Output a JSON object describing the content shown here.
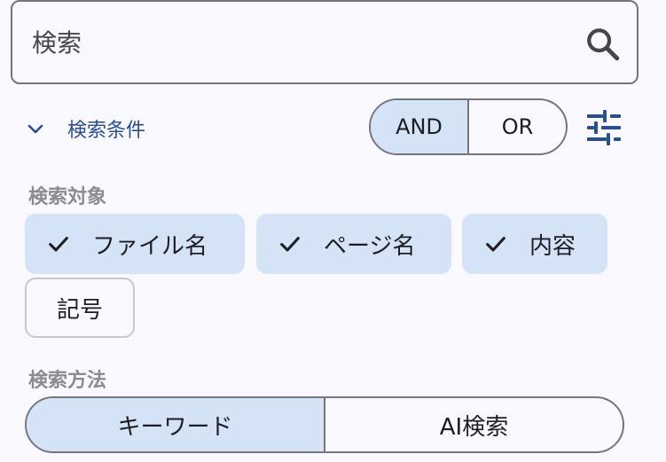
{
  "search": {
    "placeholder": "検索",
    "icon": "search-icon"
  },
  "conditions": {
    "label": "検索条件",
    "expanded": true,
    "logic": {
      "options": [
        "AND",
        "OR"
      ],
      "selected": "AND"
    },
    "filter_icon": "tune-icon"
  },
  "target": {
    "title": "検索対象",
    "chips": [
      {
        "label": "ファイル名",
        "selected": true
      },
      {
        "label": "ページ名",
        "selected": true
      },
      {
        "label": "内容",
        "selected": true
      },
      {
        "label": "記号",
        "selected": false
      }
    ]
  },
  "method": {
    "title": "検索方法",
    "options": [
      "キーワード",
      "AI検索"
    ],
    "selected": "キーワード"
  },
  "colors": {
    "accent": "#2b4f8a",
    "selected_bg": "#d5e3f7",
    "border": "#73767f",
    "background": "#f8f8fd"
  }
}
